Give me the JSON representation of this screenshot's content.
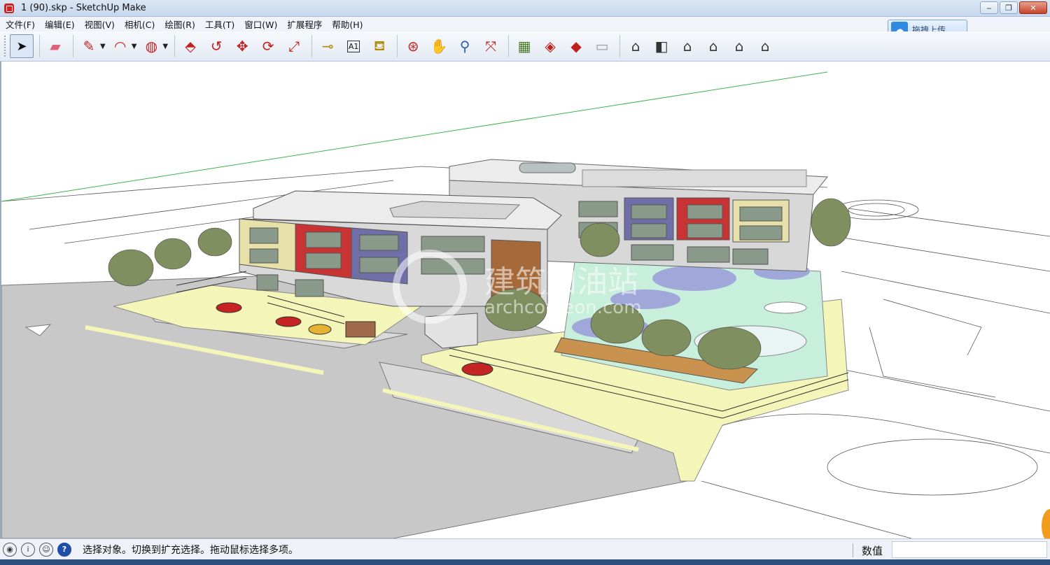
{
  "window": {
    "title": "1 (90).skp - SketchUp Make",
    "controls": {
      "minimize": "‒",
      "maximize": "❐",
      "close": "✕"
    }
  },
  "menu": {
    "items": [
      "文件(F)",
      "编辑(E)",
      "视图(V)",
      "相机(C)",
      "绘图(R)",
      "工具(T)",
      "窗口(W)",
      "扩展程序",
      "帮助(H)"
    ]
  },
  "upload": {
    "label": "拖拽上传"
  },
  "toolbar": {
    "tools": [
      {
        "name": "select-tool",
        "glyph": "➤"
      },
      {
        "name": "eraser-tool",
        "glyph": "▱"
      },
      {
        "name": "pencil-tool",
        "glyph": "✎"
      },
      {
        "name": "arc-tool",
        "glyph": "◠"
      },
      {
        "name": "shape-tool",
        "glyph": "◍"
      },
      {
        "name": "push-pull-tool",
        "glyph": "⬘"
      },
      {
        "name": "follow-me-tool",
        "glyph": "↺"
      },
      {
        "name": "move-tool",
        "glyph": "✥"
      },
      {
        "name": "rotate-tool",
        "glyph": "⟳"
      },
      {
        "name": "scale-tool",
        "glyph": "⤢"
      },
      {
        "name": "tape-measure-tool",
        "glyph": "⊸"
      },
      {
        "name": "text-tool",
        "glyph": "A1"
      },
      {
        "name": "paint-bucket-tool",
        "glyph": "⛾"
      },
      {
        "name": "orbit-tool",
        "glyph": "⊛"
      },
      {
        "name": "pan-tool",
        "glyph": "✋"
      },
      {
        "name": "zoom-tool",
        "glyph": "⚲"
      },
      {
        "name": "zoom-extents-tool",
        "glyph": "⤧"
      },
      {
        "name": "warehouse-tool",
        "glyph": "▦"
      },
      {
        "name": "share-model-tool",
        "glyph": "◈"
      },
      {
        "name": "components-tool",
        "glyph": "◆"
      },
      {
        "name": "send-to-layout-tool",
        "glyph": "▭"
      },
      {
        "name": "iso-view",
        "glyph": "⌂"
      },
      {
        "name": "top-view",
        "glyph": "◧"
      },
      {
        "name": "front-view",
        "glyph": "⌂"
      },
      {
        "name": "right-view",
        "glyph": "⌂"
      },
      {
        "name": "back-view",
        "glyph": "⌂"
      },
      {
        "name": "left-view",
        "glyph": "⌂"
      }
    ]
  },
  "viewport": {
    "watermark_cn": "建筑加油站",
    "watermark_en": "archcomeon.com"
  },
  "status": {
    "text": "选择对象。切换到扩充选择。拖动鼠标选择多项。",
    "measurements_label": "数值",
    "measurements_value": ""
  },
  "colors": {
    "road": "#c6c6c6",
    "lawn": "#f3f6b8",
    "playground": "#c8eedc",
    "water": "#9fa8d8",
    "roof": "#e8e8e8",
    "accent_red": "#c83434",
    "accent_purple": "#6f6ea6"
  }
}
